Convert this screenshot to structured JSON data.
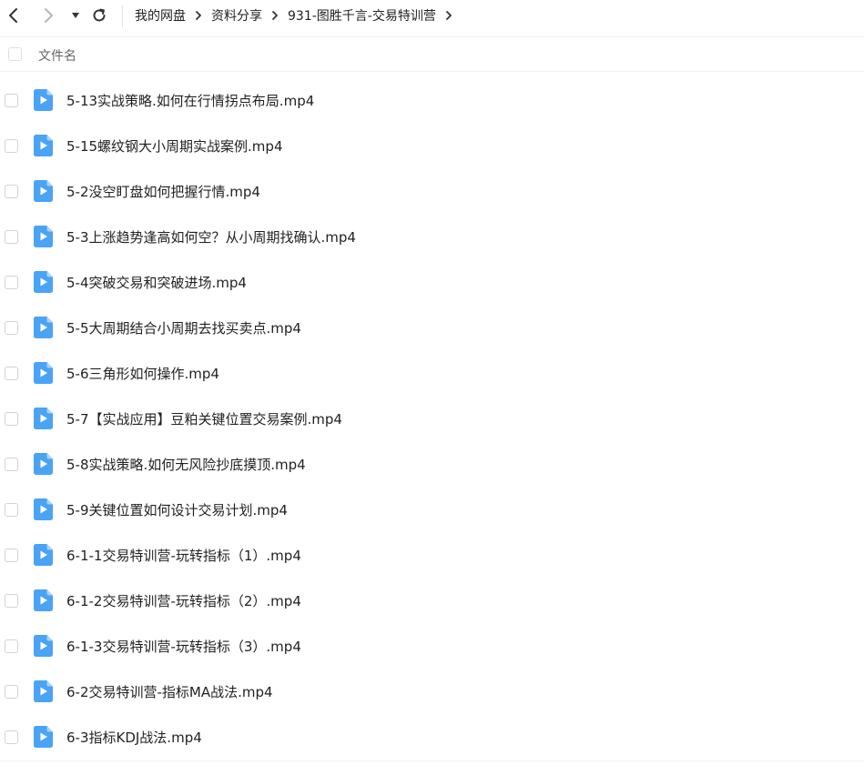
{
  "nav": {
    "back_icon": "chevron-left-icon",
    "forward_icon": "chevron-right-icon",
    "dropdown_icon": "caret-down-icon",
    "refresh_icon": "refresh-icon"
  },
  "breadcrumb": [
    {
      "label": "我的网盘"
    },
    {
      "label": "资料分享"
    },
    {
      "label": "931-图胜千言-交易特训营"
    }
  ],
  "header": {
    "column_label": "文件名"
  },
  "files": [
    {
      "name": "5-13实战策略.如何在行情拐点布局.mp4"
    },
    {
      "name": "5-15螺纹钢大小周期实战案例.mp4"
    },
    {
      "name": "5-2没空盯盘如何把握行情.mp4"
    },
    {
      "name": "5-3上涨趋势逢高如何空？从小周期找确认.mp4"
    },
    {
      "name": "5-4突破交易和突破进场.mp4"
    },
    {
      "name": "5-5大周期结合小周期去找买卖点.mp4"
    },
    {
      "name": "5-6三角形如何操作.mp4"
    },
    {
      "name": "5-7【实战应用】豆粕关键位置交易案例.mp4"
    },
    {
      "name": "5-8实战策略.如何无风险抄底摸顶.mp4"
    },
    {
      "name": "5-9关键位置如何设计交易计划.mp4"
    },
    {
      "name": "6-1-1交易特训营-玩转指标（1）.mp4"
    },
    {
      "name": "6-1-2交易特训营-玩转指标（2）.mp4"
    },
    {
      "name": "6-1-3交易特训营-玩转指标（3）.mp4"
    },
    {
      "name": "6-2交易特训营-指标MA战法.mp4"
    },
    {
      "name": "6-3指标KDJ战法.mp4"
    }
  ],
  "colors": {
    "video_icon": "#4aa3f5",
    "text": "#222222",
    "muted": "#666666",
    "border": "#efefef"
  }
}
